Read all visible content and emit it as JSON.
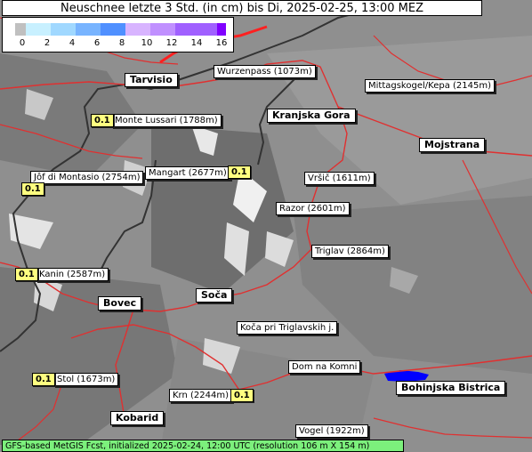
{
  "title": "Neuschnee letzte 3 Std. (in cm) bis Di, 2025-02-25, 13:00 MEZ",
  "legend": {
    "ticks": [
      "0",
      "2",
      "4",
      "6",
      "8",
      "10",
      "12",
      "14",
      "16"
    ],
    "colors": [
      "#c0c0c0",
      "#c8f0ff",
      "#a0d8ff",
      "#78b4ff",
      "#5090ff",
      "#d8b4ff",
      "#c090ff",
      "#a060ff",
      "#8000ff"
    ]
  },
  "peaks": {
    "wurzenpass": "Wurzenpass (1073m)",
    "mittagskogel": "Mittagskogel/Kepa (2145m)",
    "monte_lussari": "Monte Lussari (1788m)",
    "jof_di_montasio": "Jôf di Montasio (2754m)",
    "mangart": "Mangart (2677m)",
    "vrsic": "Vršič (1611m)",
    "razor": "Razor (2601m)",
    "triglav": "Triglav (2864m)",
    "kanin": "Kanin (2587m)",
    "koca": "Koča pri Triglavskih j.",
    "dom_na_komni": "Dom na Komni",
    "stol": "Stol (1673m)",
    "krn": "Krn (2244m)",
    "vogel": "Vogel (1922m)"
  },
  "towns": {
    "tarvisio": "Tarvisio",
    "kranjska_gora": "Kranjska Gora",
    "mojstrana": "Mojstrana",
    "bovec": "Bovec",
    "soca": "Soča",
    "bohinjska_bistrica": "Bohinjska Bistrica",
    "kobarid": "Kobarid"
  },
  "values": {
    "monte_lussari": "0.1",
    "mangart": "0.1",
    "jof_di_montasio": "0.1",
    "kanin": "0.1",
    "stol": "0.1",
    "krn": "0.1"
  },
  "footer": "GFS-based MetGIS Fcst, initialized 2025-02-24, 12:00 UTC  (resolution 106 m X 154 m)"
}
